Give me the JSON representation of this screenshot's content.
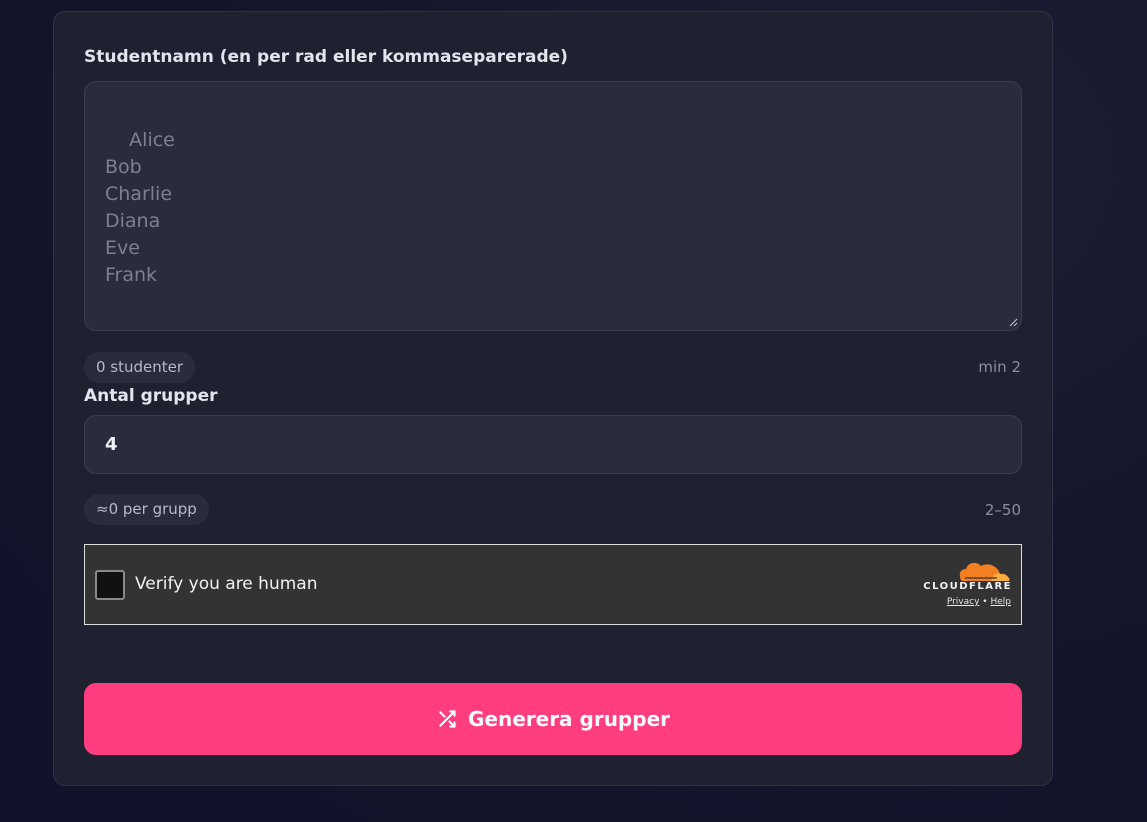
{
  "names_section": {
    "label": "Studentnamn (en per rad eller kommaseparerade)",
    "placeholder": "Alice\nBob\nCharlie\nDiana\nEve\nFrank",
    "value": "",
    "count_label": "0 studenter",
    "min_hint": "min 2"
  },
  "groups_section": {
    "label": "Antal grupper",
    "value": "4",
    "per_group_label": "≈0 per grupp",
    "range_hint": "2–50"
  },
  "captcha": {
    "label": "Verify you are human",
    "brand": "CLOUDFLARE",
    "privacy_link": "Privacy",
    "separator": "•",
    "help_link": "Help",
    "brand_color": "#f38020"
  },
  "submit": {
    "label": "Generera grupper",
    "icon": "shuffle-icon",
    "color": "#ff3d7f"
  }
}
